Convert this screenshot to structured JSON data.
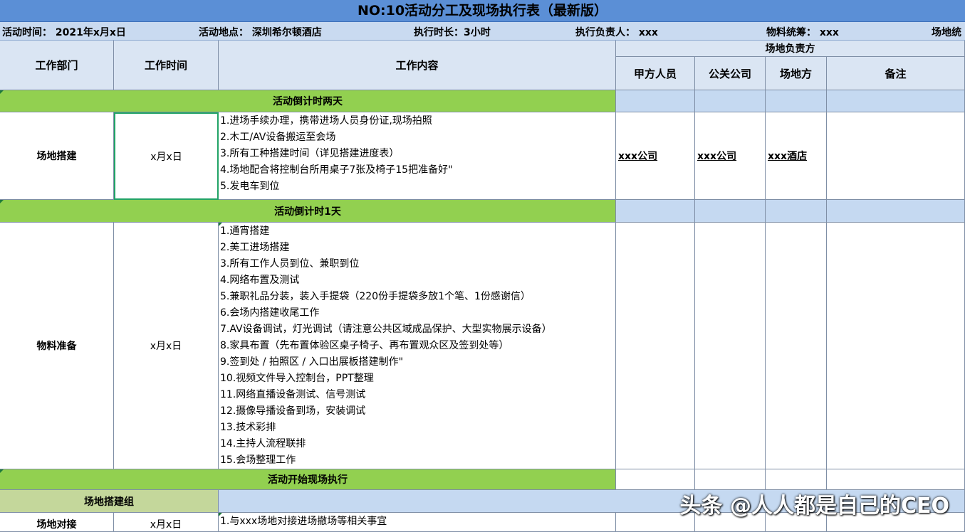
{
  "title": "NO:10活动分工及现场执行表（最新版）",
  "info": {
    "time": "活动时间：   2021年x月x日",
    "place": "活动地点：  深圳希尔顿酒店",
    "duration": "执行时长：3小时",
    "leader": "执行负责人：  xxx",
    "material": "物料统筹：  xxx",
    "venue": "场地统"
  },
  "headers": {
    "dept": "工作部门",
    "time": "工作时间",
    "content": "工作内容",
    "venue_owner": "场地负责方",
    "party_a": "甲方人员",
    "pr": "公关公司",
    "venue": "场地方",
    "note": "备注"
  },
  "sections": {
    "s1": "活动倒计时两天",
    "s2": "活动倒计时1天",
    "s3": "活动开始现场执行"
  },
  "rows": {
    "r1": {
      "dept": "场地搭建",
      "time": "x月x日",
      "items": [
        "1.进场手续办理，携带进场人员身份证,现场拍照",
        "2.木工/AV设备搬运至会场",
        "3.所有工种搭建时间（详见搭建进度表）",
        "4.场地配合将控制台所用桌子7张及椅子15把准备好\"",
        "5.发电车到位"
      ],
      "party_a": "xxx公司",
      "pr": "xxx公司",
      "venue": "xxx酒店"
    },
    "r2": {
      "dept": "物料准备",
      "time": "x月x日",
      "items": [
        "1.通宵搭建",
        "2.美工进场搭建",
        "3.所有工作人员到位、兼职到位",
        "4.网络布置及测试",
        "5.兼职礼品分装，装入手提袋（220份手提袋多放1个笔、1份感谢信）",
        "6.会场内搭建收尾工作",
        "7.AV设备调试，灯光调试（请注意公共区域成品保护、大型实物展示设备）",
        "8.家具布置（先布置体验区桌子椅子、再布置观众区及签到处等）",
        "9.签到处 / 拍照区 / 入口出展板搭建制作\"",
        "10.视频文件导入控制台，PPT整理",
        "11.网络直播设备测试、信号测试",
        "12.摄像导播设备到场，安装调试",
        "13.技术彩排",
        "14.主持人流程联排",
        "15.会场整理工作"
      ]
    },
    "group": "场地搭建组",
    "r3": {
      "dept": "场地对接",
      "time": "x月x日",
      "items": [
        "1.与xxx场地对接进场撤场等相关事宜"
      ]
    }
  },
  "watermark": "头条 @人人都是自己的CEO",
  "colors": {
    "title_bg": "#5b8fd6",
    "header_bg": "#dae5f3",
    "section_green": "#92d050",
    "group_green": "#c4d79b",
    "light_blue": "#c5d9f1",
    "selection": "#21a366"
  }
}
